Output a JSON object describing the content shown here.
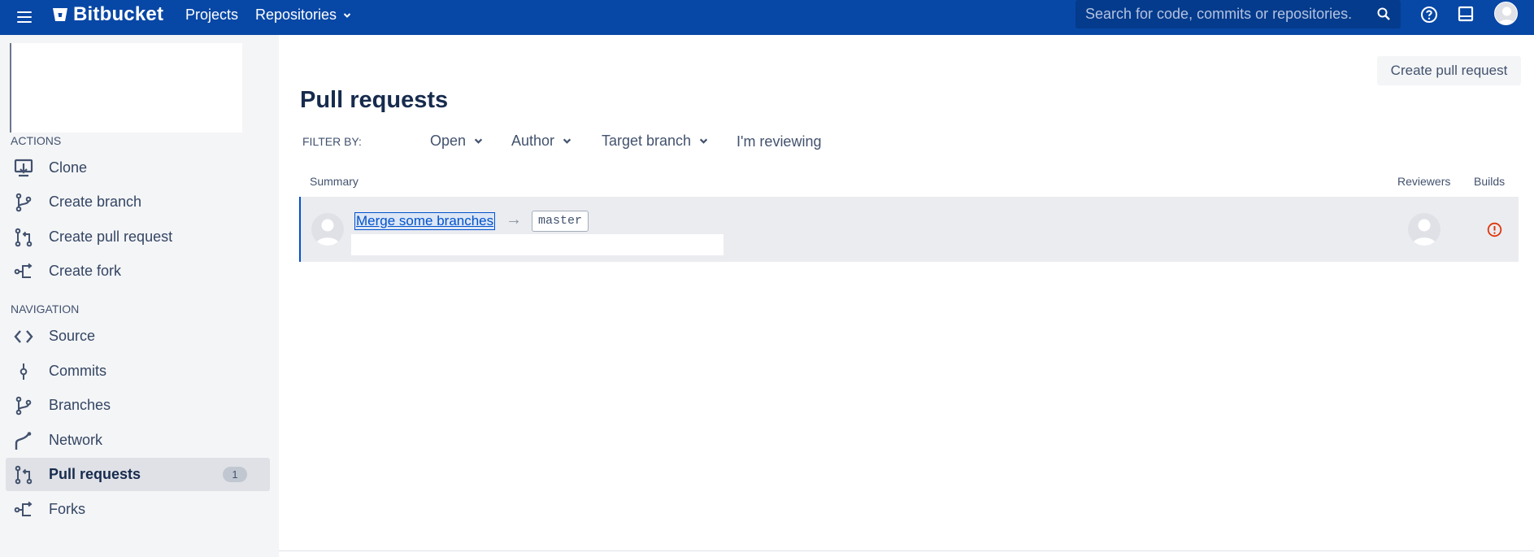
{
  "topbar": {
    "brand": "Bitbucket",
    "nav": {
      "projects": "Projects",
      "repositories": "Repositories"
    },
    "search_placeholder": "Search for code, commits or repositories...",
    "icons": [
      "menu-icon",
      "bitbucket-logo-icon",
      "chevron-down-icon",
      "search-icon",
      "help-icon",
      "inbox-icon",
      "user-avatar"
    ]
  },
  "sidebar": {
    "actions_label": "ACTIONS",
    "actions": [
      {
        "label": "Clone",
        "icon": "clone-icon"
      },
      {
        "label": "Create branch",
        "icon": "branch-icon"
      },
      {
        "label": "Create pull request",
        "icon": "pull-request-icon"
      },
      {
        "label": "Create fork",
        "icon": "fork-icon"
      }
    ],
    "navigation_label": "NAVIGATION",
    "navigation": [
      {
        "label": "Source",
        "icon": "code-icon"
      },
      {
        "label": "Commits",
        "icon": "commit-icon"
      },
      {
        "label": "Branches",
        "icon": "branch-icon"
      },
      {
        "label": "Network",
        "icon": "network-icon"
      },
      {
        "label": "Pull requests",
        "icon": "pull-request-icon",
        "badge": "1",
        "active": true
      },
      {
        "label": "Forks",
        "icon": "fork-icon"
      }
    ]
  },
  "main": {
    "create_button": "Create pull request",
    "title": "Pull requests",
    "filter_label": "FILTER BY:",
    "filters": {
      "state": "Open",
      "author": "Author",
      "target": "Target branch",
      "reviewing": "I'm reviewing"
    },
    "columns": {
      "summary": "Summary",
      "reviewers": "Reviewers",
      "builds": "Builds"
    },
    "pull_requests": [
      {
        "title": "Merge some branches",
        "target_branch": "master",
        "build_status": "failed",
        "build_color": "#de350b"
      }
    ]
  },
  "colors": {
    "header_bg": "#0747a6",
    "link": "#0052cc",
    "sidebar_bg": "#f4f5f7",
    "error": "#de350b"
  }
}
